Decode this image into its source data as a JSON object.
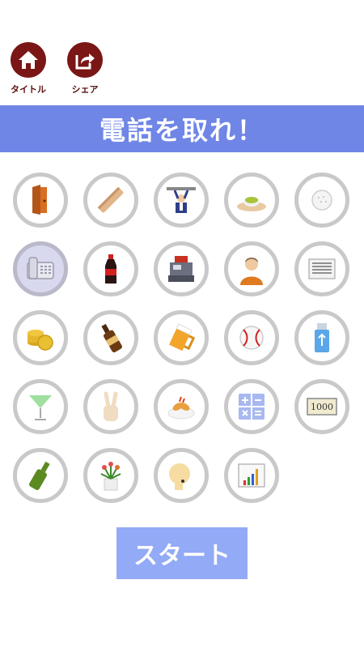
{
  "header": {
    "title_button_label": "タイトル",
    "share_button_label": "シェア"
  },
  "banner": {
    "text": "電話を取れ！"
  },
  "start_button": {
    "label": "スタート"
  },
  "items": [
    {
      "icon": "door-icon"
    },
    {
      "icon": "wooden-plank-icon"
    },
    {
      "icon": "man-holding-bar-icon"
    },
    {
      "icon": "matcha-dish-icon"
    },
    {
      "icon": "golf-ball-icon"
    },
    {
      "icon": "telephone-icon",
      "selected": true
    },
    {
      "icon": "cola-bottle-icon"
    },
    {
      "icon": "cash-register-icon"
    },
    {
      "icon": "man-portrait-icon"
    },
    {
      "icon": "newspaper-icon"
    },
    {
      "icon": "coins-icon"
    },
    {
      "icon": "beer-bottle-icon"
    },
    {
      "icon": "beer-mug-icon"
    },
    {
      "icon": "baseball-icon"
    },
    {
      "icon": "usb-drive-icon"
    },
    {
      "icon": "cocktail-glass-icon"
    },
    {
      "icon": "peace-hand-icon"
    },
    {
      "icon": "shrimp-fry-icon"
    },
    {
      "icon": "calculator-icon"
    },
    {
      "icon": "banknote-icon",
      "text": "1000"
    },
    {
      "icon": "wine-bottle-icon"
    },
    {
      "icon": "flower-pot-icon"
    },
    {
      "icon": "bald-head-icon"
    },
    {
      "icon": "bar-chart-icon"
    }
  ]
}
